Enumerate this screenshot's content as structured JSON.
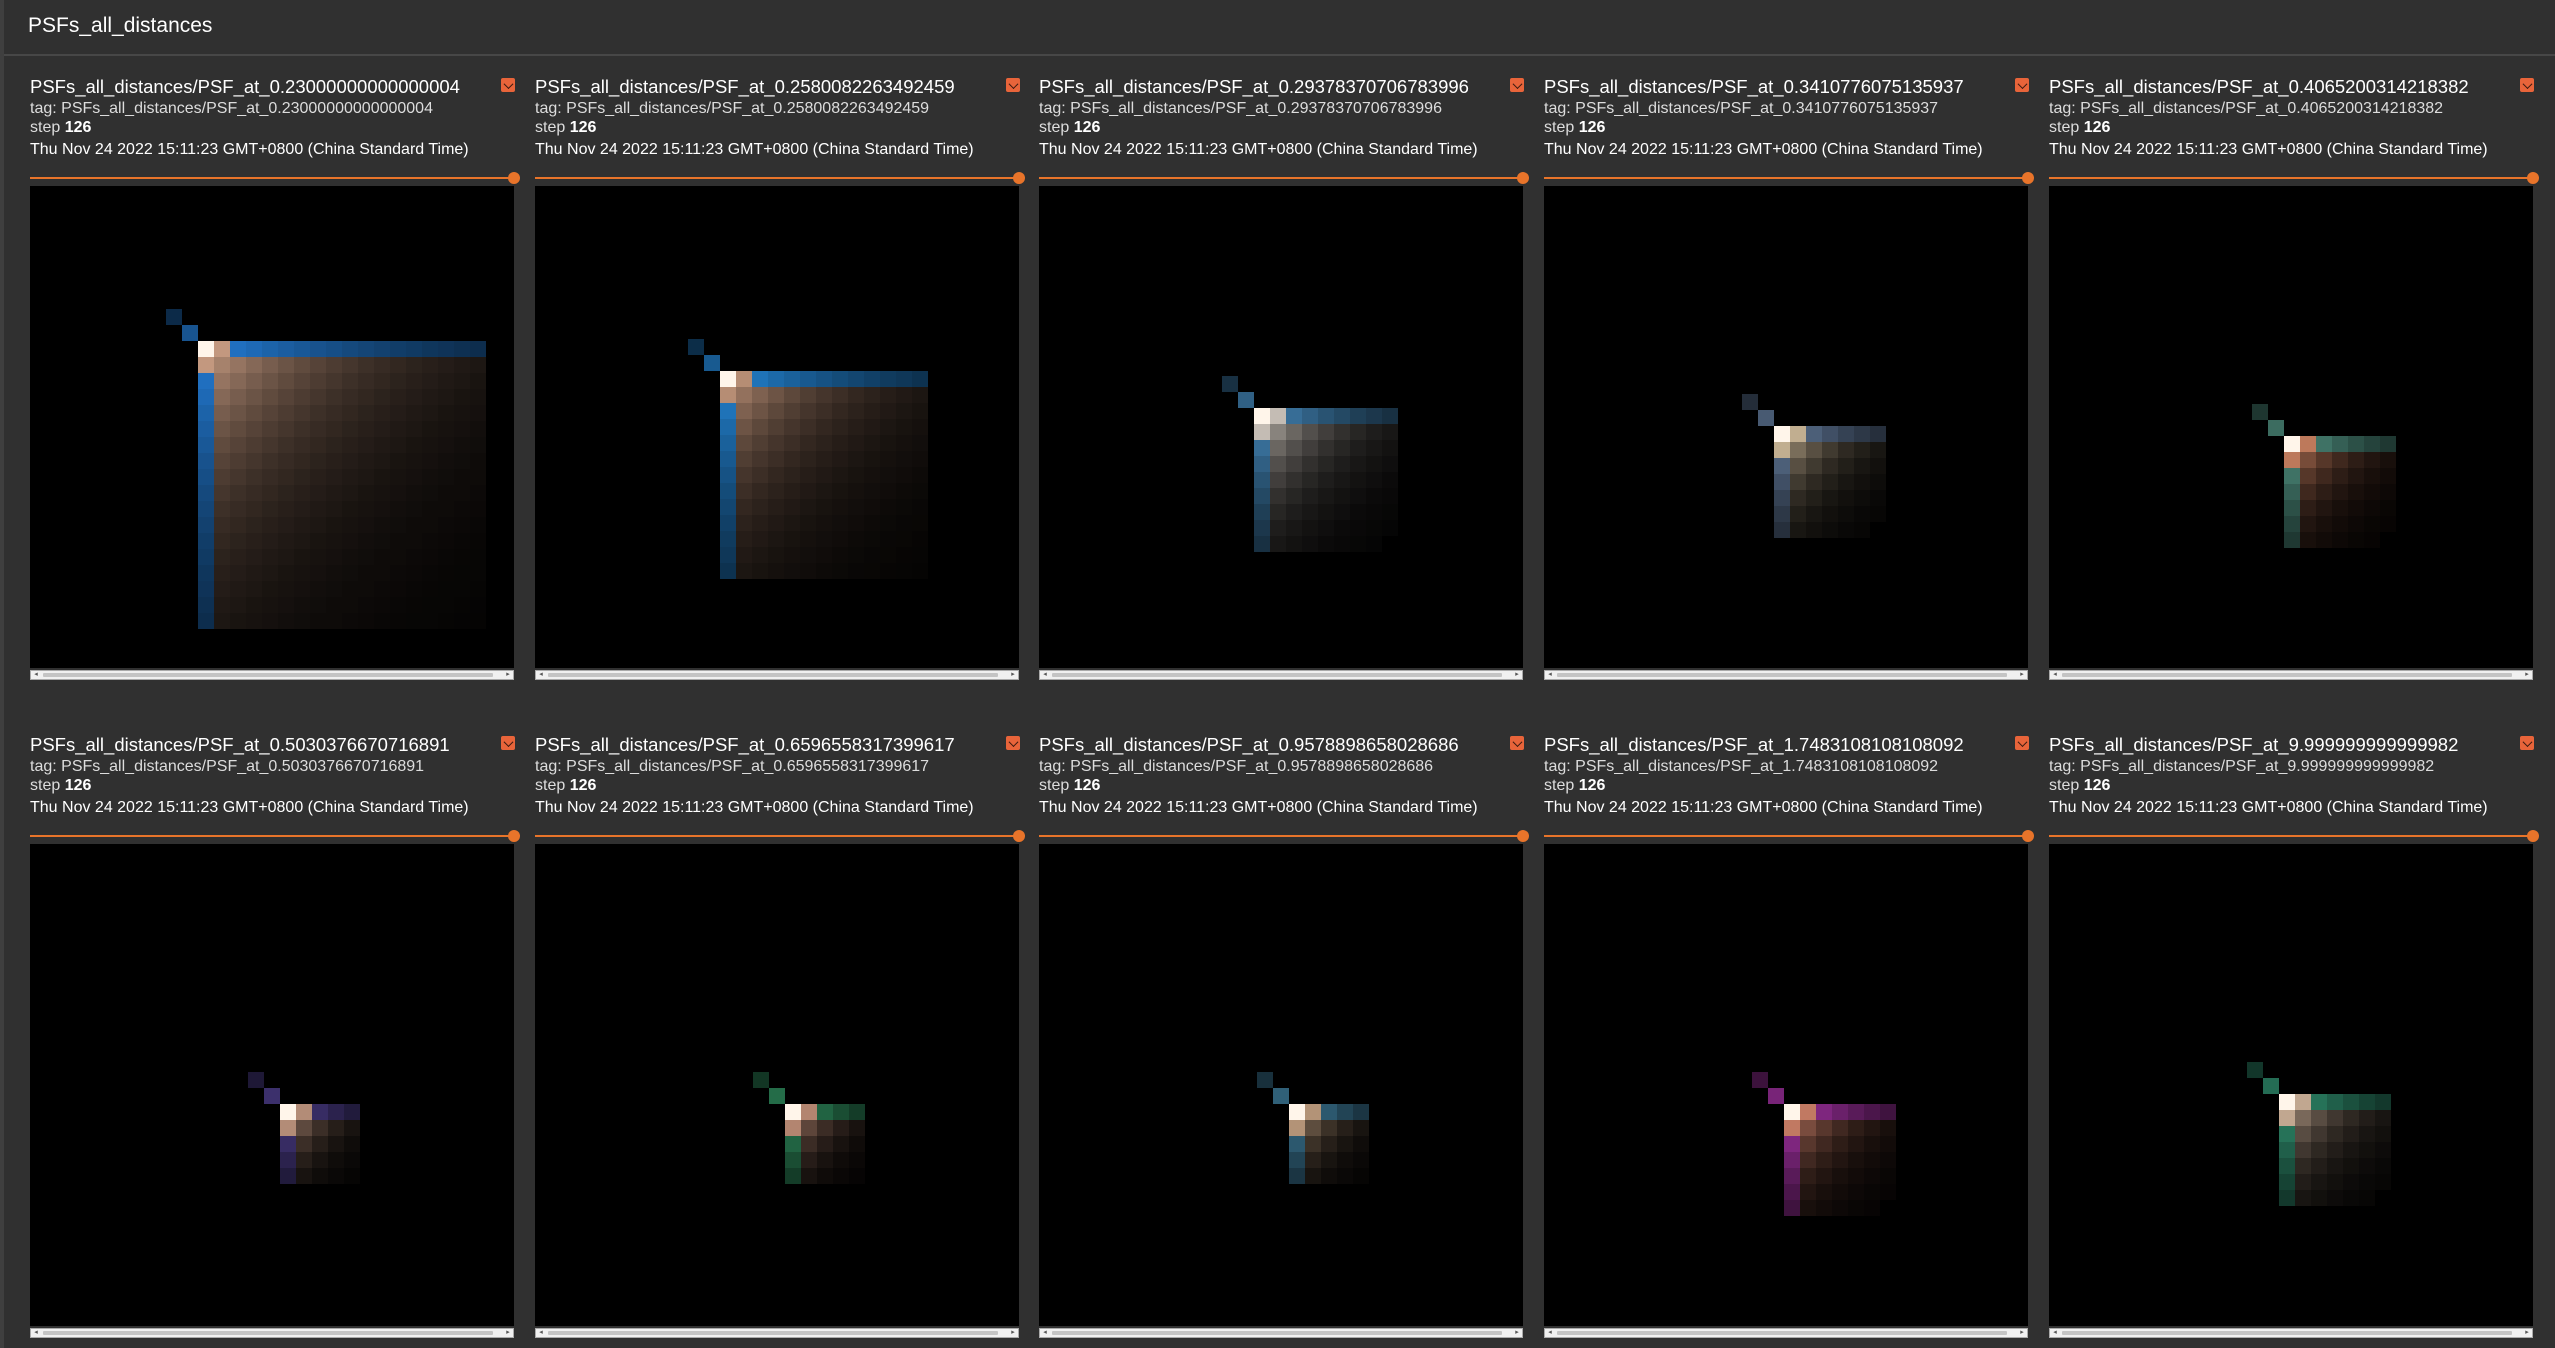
{
  "group": {
    "title": "PSFs_all_distances"
  },
  "step_label": "step",
  "tag_prefix": "tag:",
  "colors": {
    "accent": "#e8742a",
    "expand_button": "#e8643a",
    "background": "#303030"
  },
  "cards": [
    {
      "title": "PSFs_all_distances/PSF_at_0.23000000000000004",
      "tag": "PSFs_all_distances/PSF_at_0.23000000000000004",
      "step": "126",
      "timestamp": "Thu Nov 24 2022 15:11:23 GMT+0800 (China Standard Time)",
      "slider_value": 1.0,
      "icon": "expand-icon"
    },
    {
      "title": "PSFs_all_distances/PSF_at_0.2580082263492459",
      "tag": "PSFs_all_distances/PSF_at_0.2580082263492459",
      "step": "126",
      "timestamp": "Thu Nov 24 2022 15:11:23 GMT+0800 (China Standard Time)",
      "slider_value": 1.0,
      "icon": "expand-icon"
    },
    {
      "title": "PSFs_all_distances/PSF_at_0.29378370706783996",
      "tag": "PSFs_all_distances/PSF_at_0.29378370706783996",
      "step": "126",
      "timestamp": "Thu Nov 24 2022 15:11:23 GMT+0800 (China Standard Time)",
      "slider_value": 1.0,
      "icon": "expand-icon"
    },
    {
      "title": "PSFs_all_distances/PSF_at_0.3410776075135937",
      "tag": "PSFs_all_distances/PSF_at_0.3410776075135937",
      "step": "126",
      "timestamp": "Thu Nov 24 2022 15:11:23 GMT+0800 (China Standard Time)",
      "slider_value": 1.0,
      "icon": "expand-icon"
    },
    {
      "title": "PSFs_all_distances/PSF_at_0.4065200314218382",
      "tag": "PSFs_all_distances/PSF_at_0.4065200314218382",
      "step": "126",
      "timestamp": "Thu Nov 24 2022 15:11:23 GMT+0800 (China Standard Time)",
      "slider_value": 1.0,
      "icon": "expand-icon"
    },
    {
      "title": "PSFs_all_distances/PSF_at_0.5030376670716891",
      "tag": "PSFs_all_distances/PSF_at_0.5030376670716891",
      "step": "126",
      "timestamp": "Thu Nov 24 2022 15:11:23 GMT+0800 (China Standard Time)",
      "slider_value": 1.0,
      "icon": "expand-icon"
    },
    {
      "title": "PSFs_all_distances/PSF_at_0.6596558317399617",
      "tag": "PSFs_all_distances/PSF_at_0.6596558317399617",
      "step": "126",
      "timestamp": "Thu Nov 24 2022 15:11:23 GMT+0800 (China Standard Time)",
      "slider_value": 1.0,
      "icon": "expand-icon"
    },
    {
      "title": "PSFs_all_distances/PSF_at_0.9578898658028686",
      "tag": "PSFs_all_distances/PSF_at_0.9578898658028686",
      "step": "126",
      "timestamp": "Thu Nov 24 2022 15:11:23 GMT+0800 (China Standard Time)",
      "slider_value": 1.0,
      "icon": "expand-icon"
    },
    {
      "title": "PSFs_all_distances/PSF_at_1.7483108108108092",
      "tag": "PSFs_all_distances/PSF_at_1.7483108108108092",
      "step": "126",
      "timestamp": "Thu Nov 24 2022 15:11:23 GMT+0800 (China Standard Time)",
      "slider_value": 1.0,
      "icon": "expand-icon"
    },
    {
      "title": "PSFs_all_distances/PSF_at_9.999999999999982",
      "tag": "PSFs_all_distances/PSF_at_9.999999999999982",
      "step": "126",
      "timestamp": "Thu Nov 24 2022 15:11:23 GMT+0800 (China Standard Time)",
      "slider_value": 1.0,
      "icon": "expand-icon"
    }
  ]
}
